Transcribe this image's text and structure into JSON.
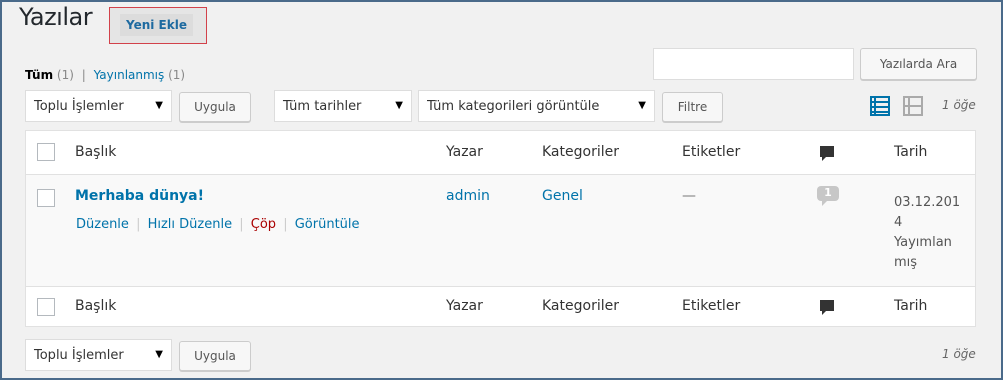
{
  "header": {
    "title": "Yazılar",
    "add_new": "Yeni Ekle"
  },
  "filters_links": {
    "all_label": "Tüm",
    "all_count": "(1)",
    "separator": "|",
    "published_label": "Yayınlanmış",
    "published_count": "(1)"
  },
  "search": {
    "placeholder": "",
    "button": "Yazılarda Ara"
  },
  "bulk_top": {
    "select": "Toplu İşlemler",
    "apply": "Uygula"
  },
  "date_filter": "Tüm tarihler",
  "category_filter": "Tüm kategorileri görüntüle",
  "filter_button": "Filtre",
  "items_count": "1 öğe",
  "columns": {
    "title": "Başlık",
    "author": "Yazar",
    "categories": "Kategoriler",
    "tags": "Etiketler",
    "date": "Tarih"
  },
  "post": {
    "title": "Merhaba dünya!",
    "author": "admin",
    "category": "Genel",
    "tags": "—",
    "comments": "1",
    "date_line1": "03.12.201",
    "date_line2": "4",
    "status_line1": "Yayımlan",
    "status_line2": "mış",
    "actions": {
      "edit": "Düzenle",
      "quick_edit": "Hızlı Düzenle",
      "trash": "Çöp",
      "view": "Görüntüle",
      "sep": "|"
    }
  },
  "bulk_bottom": {
    "select": "Toplu İşlemler",
    "apply": "Uygula"
  },
  "colors": {
    "accent": "#0073aa",
    "trash": "#a00000",
    "highlight_border": "#d2414a"
  }
}
